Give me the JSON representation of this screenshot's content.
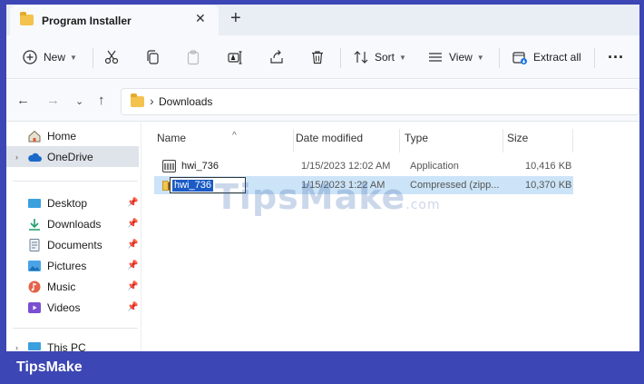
{
  "window": {
    "tab_title": "Program Installer",
    "tab_close": "✕",
    "new_tab": "+"
  },
  "toolbar": {
    "new_label": "New",
    "sort_label": "Sort",
    "view_label": "View",
    "extract_label": "Extract all",
    "more": "···"
  },
  "address": {
    "separator": "›",
    "path": "Downloads"
  },
  "sidebar": {
    "home": "Home",
    "onedrive": "OneDrive",
    "desktop": "Desktop",
    "downloads": "Downloads",
    "documents": "Documents",
    "pictures": "Pictures",
    "music": "Music",
    "videos": "Videos",
    "thispc": "This PC"
  },
  "columns": {
    "name": "Name",
    "date": "Date modified",
    "type": "Type",
    "size": "Size"
  },
  "files": [
    {
      "name": "hwi_736",
      "date": "1/15/2023 12:02 AM",
      "type": "Application",
      "size": "10,416 KB"
    },
    {
      "name": "hwi_736",
      "date": "1/15/2023 1:22 AM",
      "type": "Compressed (zipp...",
      "size": "10,370 KB"
    }
  ],
  "watermark": {
    "text": "TipsMake",
    "suffix": ".com"
  },
  "brand": "TipsMake",
  "colors": {
    "accent": "#3c46b4",
    "selection": "#cce4f7",
    "rename_highlight": "#1a5bc5"
  }
}
